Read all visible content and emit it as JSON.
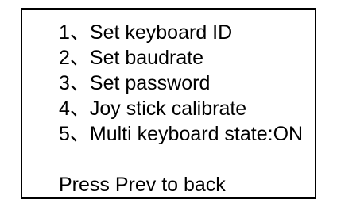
{
  "menu": {
    "items": [
      {
        "label": "1、Set keyboard ID"
      },
      {
        "label": "2、Set baudrate"
      },
      {
        "label": "3、Set password"
      },
      {
        "label": "4、Joy stick calibrate"
      },
      {
        "label": "5、Multi keyboard state:ON"
      }
    ]
  },
  "footer": {
    "hint": "Press Prev to back"
  },
  "colors": {
    "background": "#ffffff",
    "text": "#000000",
    "border": "#000000"
  }
}
